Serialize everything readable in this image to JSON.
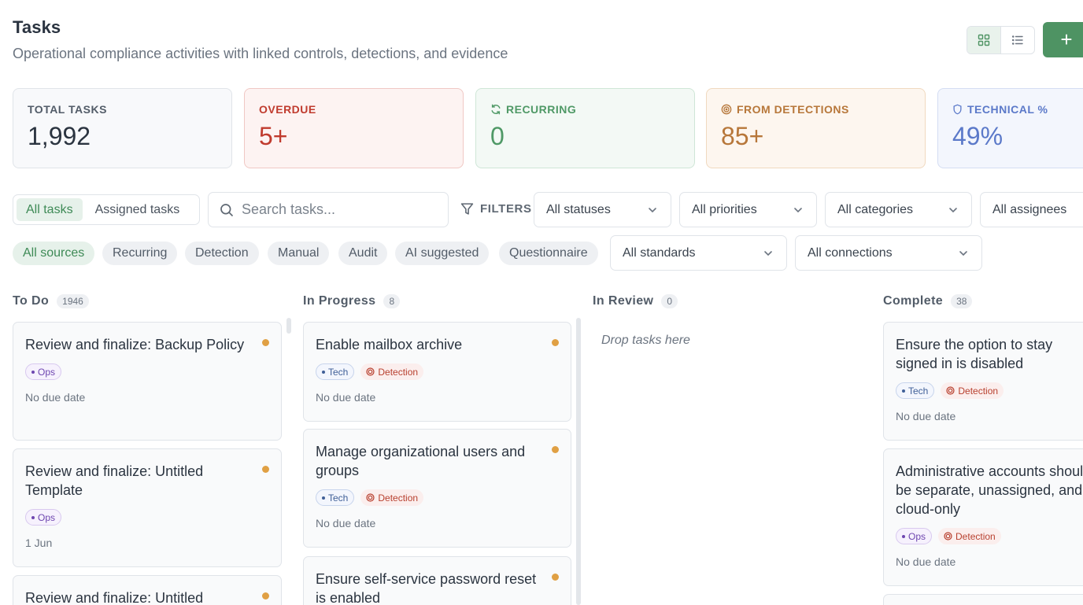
{
  "header": {
    "title": "Tasks",
    "subtitle": "Operational compliance activities with linked controls, detections, and evidence",
    "add_label": "+"
  },
  "stats": [
    {
      "label": "TOTAL TASKS",
      "value": "1,992"
    },
    {
      "label": "OVERDUE",
      "value": "5+"
    },
    {
      "label": "RECURRING",
      "value": "0"
    },
    {
      "label": "FROM DETECTIONS",
      "value": "85+"
    },
    {
      "label": "TECHNICAL %",
      "value": "49%"
    }
  ],
  "tabs": {
    "all": "All tasks",
    "assigned": "Assigned tasks"
  },
  "search": {
    "placeholder": "Search tasks..."
  },
  "filters": {
    "label": "FILTERS",
    "statuses": "All statuses",
    "priorities": "All priorities",
    "categories": "All categories",
    "assignees": "All assignees",
    "standards": "All standards",
    "connections": "All connections"
  },
  "sources": [
    "All sources",
    "Recurring",
    "Detection",
    "Manual",
    "Audit",
    "AI suggested",
    "Questionnaire"
  ],
  "tag_labels": {
    "tech": "Tech",
    "ops": "Ops",
    "detection": "Detection"
  },
  "columns": {
    "todo": {
      "title": "To Do",
      "count": "1946",
      "cards": [
        {
          "title": "Review and finalize: Backup Policy",
          "due": "No due date"
        },
        {
          "title": "Review and finalize: Untitled Template",
          "due": "1 Jun"
        },
        {
          "title": "Review and finalize: Untitled"
        }
      ]
    },
    "inprogress": {
      "title": "In Progress",
      "count": "8",
      "cards": [
        {
          "title": "Enable mailbox archive",
          "due": "No due date"
        },
        {
          "title": "Manage organizational users and groups",
          "due": "No due date"
        },
        {
          "title": "Ensure self-service password reset is enabled"
        }
      ]
    },
    "inreview": {
      "title": "In Review",
      "count": "0",
      "empty": "Drop tasks here"
    },
    "complete": {
      "title": "Complete",
      "count": "38",
      "cards": [
        {
          "title": "Ensure the option to stay signed in is disabled",
          "due": "No due date"
        },
        {
          "title": "Administrative accounts should be separate, unassigned, and cloud-only",
          "due": "No due date"
        }
      ]
    }
  },
  "colors": {
    "accent": "#4e9363",
    "priority_dot": "#e0a044",
    "overdue": "#c03b2e"
  }
}
